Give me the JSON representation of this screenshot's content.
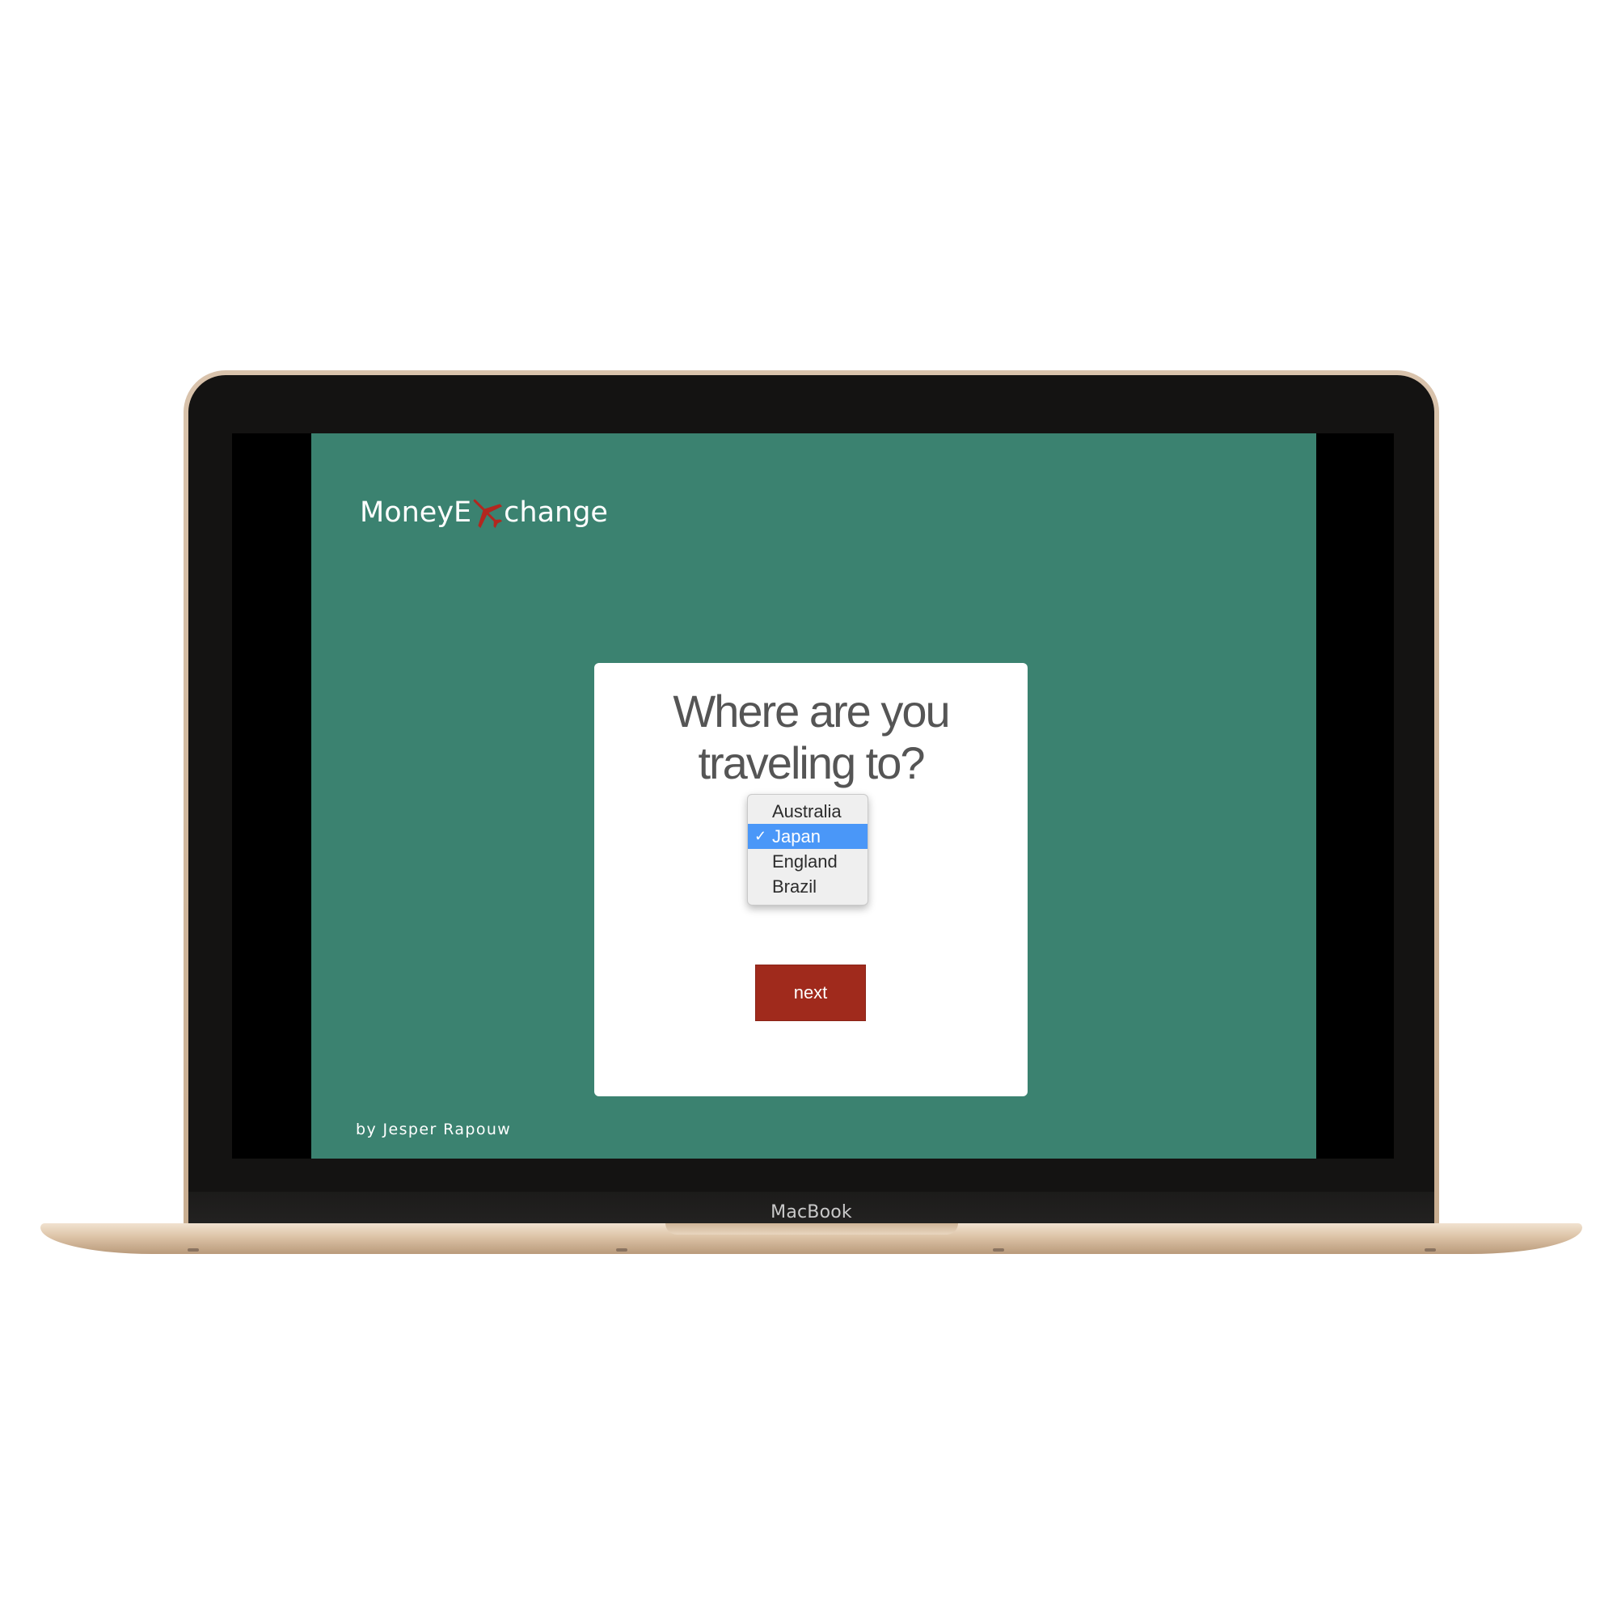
{
  "device": {
    "label": "MacBook"
  },
  "app": {
    "logo": {
      "text_before": "MoneyE",
      "text_after": "change",
      "icon": "airplane-icon"
    },
    "card": {
      "question_line1": "Where are you",
      "question_line2": "traveling to?",
      "destination_select": {
        "options": [
          "Australia",
          "Japan",
          "England",
          "Brazil"
        ],
        "selected": "Japan",
        "check_glyph": "✓"
      },
      "next_label": "next"
    },
    "byline": "by Jesper Rapouw"
  },
  "colors": {
    "background": "#3b8270",
    "card": "#ffffff",
    "button": "#a02a1c",
    "highlight": "#4a97f8",
    "plane": "#b3271f"
  }
}
